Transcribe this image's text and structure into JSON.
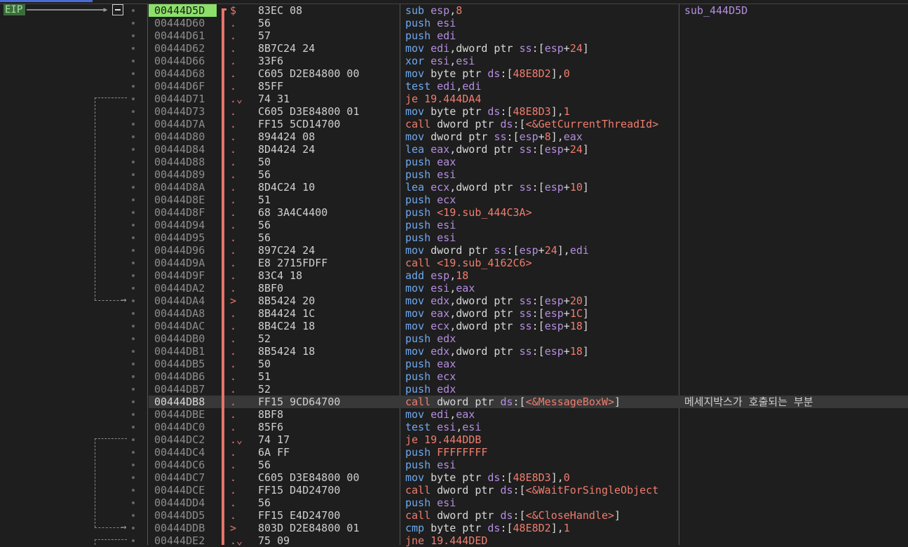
{
  "gutter": {
    "eip_label": "EIP"
  },
  "rows": [
    {
      "addr": "00444D5D",
      "mark": "$",
      "bytes": "83EC 08",
      "dis": [
        [
          "mn",
          "sub "
        ],
        [
          "reg",
          "esp"
        ],
        [
          "txt",
          ","
        ],
        [
          "num",
          "8"
        ]
      ],
      "comment": "sub_444D5D"
    },
    {
      "addr": "00444D60",
      "mark": ".",
      "bytes": "56",
      "dis": [
        [
          "mn",
          "push "
        ],
        [
          "reg",
          "esi"
        ]
      ]
    },
    {
      "addr": "00444D61",
      "mark": ".",
      "bytes": "57",
      "dis": [
        [
          "mn",
          "push "
        ],
        [
          "reg",
          "edi"
        ]
      ]
    },
    {
      "addr": "00444D62",
      "mark": ".",
      "bytes": "8B7C24 24",
      "dis": [
        [
          "mn",
          "mov "
        ],
        [
          "reg",
          "edi"
        ],
        [
          "txt",
          ",dword ptr "
        ],
        [
          "seg",
          "ss"
        ],
        [
          "txt",
          ":["
        ],
        [
          "reg",
          "esp"
        ],
        [
          "txt",
          "+"
        ],
        [
          "num",
          "24"
        ],
        [
          "txt",
          "]"
        ]
      ]
    },
    {
      "addr": "00444D66",
      "mark": ".",
      "bytes": "33F6",
      "dis": [
        [
          "mn",
          "xor "
        ],
        [
          "reg",
          "esi"
        ],
        [
          "txt",
          ","
        ],
        [
          "reg",
          "esi"
        ]
      ]
    },
    {
      "addr": "00444D68",
      "mark": ".",
      "bytes": "C605 D2E84800 00",
      "dis": [
        [
          "mn",
          "mov "
        ],
        [
          "txt",
          "byte ptr "
        ],
        [
          "seg",
          "ds"
        ],
        [
          "txt",
          ":["
        ],
        [
          "num",
          "48E8D2"
        ],
        [
          "txt",
          "],"
        ],
        [
          "num",
          "0"
        ]
      ]
    },
    {
      "addr": "00444D6F",
      "mark": ".",
      "bytes": "85FF",
      "dis": [
        [
          "mn",
          "test "
        ],
        [
          "reg",
          "edi"
        ],
        [
          "txt",
          ","
        ],
        [
          "reg",
          "edi"
        ]
      ]
    },
    {
      "addr": "00444D71",
      "mark": ".⌄",
      "bytes": "74 31",
      "dis": [
        [
          "j",
          "je 19.444DA4"
        ]
      ]
    },
    {
      "addr": "00444D73",
      "mark": ".",
      "bytes": "C605 D3E84800 01",
      "dis": [
        [
          "mn",
          "mov "
        ],
        [
          "txt",
          "byte ptr "
        ],
        [
          "seg",
          "ds"
        ],
        [
          "txt",
          ":["
        ],
        [
          "num",
          "48E8D3"
        ],
        [
          "txt",
          "],"
        ],
        [
          "num",
          "1"
        ]
      ]
    },
    {
      "addr": "00444D7A",
      "mark": ".",
      "bytes": "FF15 5CD14700",
      "dis": [
        [
          "call",
          "call "
        ],
        [
          "txt",
          "dword ptr "
        ],
        [
          "seg",
          "ds"
        ],
        [
          "txt",
          ":["
        ],
        [
          "sym",
          "<&GetCurrentThreadId>"
        ]
      ]
    },
    {
      "addr": "00444D80",
      "mark": ".",
      "bytes": "894424 08",
      "dis": [
        [
          "mn",
          "mov "
        ],
        [
          "txt",
          "dword ptr "
        ],
        [
          "seg",
          "ss"
        ],
        [
          "txt",
          ":["
        ],
        [
          "reg",
          "esp"
        ],
        [
          "txt",
          "+"
        ],
        [
          "num",
          "8"
        ],
        [
          "txt",
          "],"
        ],
        [
          "reg",
          "eax"
        ]
      ]
    },
    {
      "addr": "00444D84",
      "mark": ".",
      "bytes": "8D4424 24",
      "dis": [
        [
          "mn",
          "lea "
        ],
        [
          "reg",
          "eax"
        ],
        [
          "txt",
          ",dword ptr "
        ],
        [
          "seg",
          "ss"
        ],
        [
          "txt",
          ":["
        ],
        [
          "reg",
          "esp"
        ],
        [
          "txt",
          "+"
        ],
        [
          "num",
          "24"
        ],
        [
          "txt",
          "]"
        ]
      ]
    },
    {
      "addr": "00444D88",
      "mark": ".",
      "bytes": "50",
      "dis": [
        [
          "mn",
          "push "
        ],
        [
          "reg",
          "eax"
        ]
      ]
    },
    {
      "addr": "00444D89",
      "mark": ".",
      "bytes": "56",
      "dis": [
        [
          "mn",
          "push "
        ],
        [
          "reg",
          "esi"
        ]
      ]
    },
    {
      "addr": "00444D8A",
      "mark": ".",
      "bytes": "8D4C24 10",
      "dis": [
        [
          "mn",
          "lea "
        ],
        [
          "reg",
          "ecx"
        ],
        [
          "txt",
          ",dword ptr "
        ],
        [
          "seg",
          "ss"
        ],
        [
          "txt",
          ":["
        ],
        [
          "reg",
          "esp"
        ],
        [
          "txt",
          "+"
        ],
        [
          "num",
          "10"
        ],
        [
          "txt",
          "]"
        ]
      ]
    },
    {
      "addr": "00444D8E",
      "mark": ".",
      "bytes": "51",
      "dis": [
        [
          "mn",
          "push "
        ],
        [
          "reg",
          "ecx"
        ]
      ]
    },
    {
      "addr": "00444D8F",
      "mark": ".",
      "bytes": "68 3A4C4400",
      "dis": [
        [
          "mn",
          "push "
        ],
        [
          "sym",
          "<19.sub_444C3A>"
        ]
      ]
    },
    {
      "addr": "00444D94",
      "mark": ".",
      "bytes": "56",
      "dis": [
        [
          "mn",
          "push "
        ],
        [
          "reg",
          "esi"
        ]
      ]
    },
    {
      "addr": "00444D95",
      "mark": ".",
      "bytes": "56",
      "dis": [
        [
          "mn",
          "push "
        ],
        [
          "reg",
          "esi"
        ]
      ]
    },
    {
      "addr": "00444D96",
      "mark": ".",
      "bytes": "897C24 24",
      "dis": [
        [
          "mn",
          "mov "
        ],
        [
          "txt",
          "dword ptr "
        ],
        [
          "seg",
          "ss"
        ],
        [
          "txt",
          ":["
        ],
        [
          "reg",
          "esp"
        ],
        [
          "txt",
          "+"
        ],
        [
          "num",
          "24"
        ],
        [
          "txt",
          "],"
        ],
        [
          "reg",
          "edi"
        ]
      ]
    },
    {
      "addr": "00444D9A",
      "mark": ".",
      "bytes": "E8 2715FDFF",
      "dis": [
        [
          "call",
          "call "
        ],
        [
          "sym",
          "<19.sub_4162C6>"
        ]
      ]
    },
    {
      "addr": "00444D9F",
      "mark": ".",
      "bytes": "83C4 18",
      "dis": [
        [
          "mn",
          "add "
        ],
        [
          "reg",
          "esp"
        ],
        [
          "txt",
          ","
        ],
        [
          "num",
          "18"
        ]
      ]
    },
    {
      "addr": "00444DA2",
      "mark": ".",
      "bytes": "8BF0",
      "dis": [
        [
          "mn",
          "mov "
        ],
        [
          "reg",
          "esi"
        ],
        [
          "txt",
          ","
        ],
        [
          "reg",
          "eax"
        ]
      ]
    },
    {
      "addr": "00444DA4",
      "mark": ">",
      "bytes": "8B5424 20",
      "dis": [
        [
          "mn",
          "mov "
        ],
        [
          "reg",
          "edx"
        ],
        [
          "txt",
          ",dword ptr "
        ],
        [
          "seg",
          "ss"
        ],
        [
          "txt",
          ":["
        ],
        [
          "reg",
          "esp"
        ],
        [
          "txt",
          "+"
        ],
        [
          "num",
          "20"
        ],
        [
          "txt",
          "]"
        ]
      ]
    },
    {
      "addr": "00444DA8",
      "mark": ".",
      "bytes": "8B4424 1C",
      "dis": [
        [
          "mn",
          "mov "
        ],
        [
          "reg",
          "eax"
        ],
        [
          "txt",
          ",dword ptr "
        ],
        [
          "seg",
          "ss"
        ],
        [
          "txt",
          ":["
        ],
        [
          "reg",
          "esp"
        ],
        [
          "txt",
          "+"
        ],
        [
          "num",
          "1C"
        ],
        [
          "txt",
          "]"
        ]
      ]
    },
    {
      "addr": "00444DAC",
      "mark": ".",
      "bytes": "8B4C24 18",
      "dis": [
        [
          "mn",
          "mov "
        ],
        [
          "reg",
          "ecx"
        ],
        [
          "txt",
          ",dword ptr "
        ],
        [
          "seg",
          "ss"
        ],
        [
          "txt",
          ":["
        ],
        [
          "reg",
          "esp"
        ],
        [
          "txt",
          "+"
        ],
        [
          "num",
          "18"
        ],
        [
          "txt",
          "]"
        ]
      ]
    },
    {
      "addr": "00444DB0",
      "mark": ".",
      "bytes": "52",
      "dis": [
        [
          "mn",
          "push "
        ],
        [
          "reg",
          "edx"
        ]
      ]
    },
    {
      "addr": "00444DB1",
      "mark": ".",
      "bytes": "8B5424 18",
      "dis": [
        [
          "mn",
          "mov "
        ],
        [
          "reg",
          "edx"
        ],
        [
          "txt",
          ",dword ptr "
        ],
        [
          "seg",
          "ss"
        ],
        [
          "txt",
          ":["
        ],
        [
          "reg",
          "esp"
        ],
        [
          "txt",
          "+"
        ],
        [
          "num",
          "18"
        ],
        [
          "txt",
          "]"
        ]
      ]
    },
    {
      "addr": "00444DB5",
      "mark": ".",
      "bytes": "50",
      "dis": [
        [
          "mn",
          "push "
        ],
        [
          "reg",
          "eax"
        ]
      ]
    },
    {
      "addr": "00444DB6",
      "mark": ".",
      "bytes": "51",
      "dis": [
        [
          "mn",
          "push "
        ],
        [
          "reg",
          "ecx"
        ]
      ]
    },
    {
      "addr": "00444DB7",
      "mark": ".",
      "bytes": "52",
      "dis": [
        [
          "mn",
          "push "
        ],
        [
          "reg",
          "edx"
        ]
      ]
    },
    {
      "addr": "00444DB8",
      "mark": ".",
      "bytes": "FF15 9CD64700",
      "dis": [
        [
          "call",
          "call "
        ],
        [
          "txt",
          "dword ptr "
        ],
        [
          "seg",
          "ds"
        ],
        [
          "txt",
          ":["
        ],
        [
          "sym",
          "<&MessageBoxW>"
        ],
        [
          "txt",
          "]"
        ]
      ],
      "comment": "메세지박스가 호출되는 부분",
      "hl": true
    },
    {
      "addr": "00444DBE",
      "mark": ".",
      "bytes": "8BF8",
      "dis": [
        [
          "mn",
          "mov "
        ],
        [
          "reg",
          "edi"
        ],
        [
          "txt",
          ","
        ],
        [
          "reg",
          "eax"
        ]
      ]
    },
    {
      "addr": "00444DC0",
      "mark": ".",
      "bytes": "85F6",
      "dis": [
        [
          "mn",
          "test "
        ],
        [
          "reg",
          "esi"
        ],
        [
          "txt",
          ","
        ],
        [
          "reg",
          "esi"
        ]
      ]
    },
    {
      "addr": "00444DC2",
      "mark": ".⌄",
      "bytes": "74 17",
      "dis": [
        [
          "j",
          "je 19.444DDB"
        ]
      ]
    },
    {
      "addr": "00444DC4",
      "mark": ".",
      "bytes": "6A FF",
      "dis": [
        [
          "mn",
          "push "
        ],
        [
          "num",
          "FFFFFFFF"
        ]
      ]
    },
    {
      "addr": "00444DC6",
      "mark": ".",
      "bytes": "56",
      "dis": [
        [
          "mn",
          "push "
        ],
        [
          "reg",
          "esi"
        ]
      ]
    },
    {
      "addr": "00444DC7",
      "mark": ".",
      "bytes": "C605 D3E84800 00",
      "dis": [
        [
          "mn",
          "mov "
        ],
        [
          "txt",
          "byte ptr "
        ],
        [
          "seg",
          "ds"
        ],
        [
          "txt",
          ":["
        ],
        [
          "num",
          "48E8D3"
        ],
        [
          "txt",
          "],"
        ],
        [
          "num",
          "0"
        ]
      ]
    },
    {
      "addr": "00444DCE",
      "mark": ".",
      "bytes": "FF15 D4D24700",
      "dis": [
        [
          "call",
          "call "
        ],
        [
          "txt",
          "dword ptr "
        ],
        [
          "seg",
          "ds"
        ],
        [
          "txt",
          ":["
        ],
        [
          "sym",
          "<&WaitForSingleObject"
        ]
      ]
    },
    {
      "addr": "00444DD4",
      "mark": ".",
      "bytes": "56",
      "dis": [
        [
          "mn",
          "push "
        ],
        [
          "reg",
          "esi"
        ]
      ]
    },
    {
      "addr": "00444DD5",
      "mark": ".",
      "bytes": "FF15 E4D24700",
      "dis": [
        [
          "call",
          "call "
        ],
        [
          "txt",
          "dword ptr "
        ],
        [
          "seg",
          "ds"
        ],
        [
          "txt",
          ":["
        ],
        [
          "sym",
          "<&CloseHandle>"
        ],
        [
          "txt",
          "]"
        ]
      ]
    },
    {
      "addr": "00444DDB",
      "mark": ">",
      "bytes": "803D D2E84800 01",
      "dis": [
        [
          "mn",
          "cmp "
        ],
        [
          "txt",
          "byte ptr "
        ],
        [
          "seg",
          "ds"
        ],
        [
          "txt",
          ":["
        ],
        [
          "num",
          "48E8D2"
        ],
        [
          "txt",
          "],"
        ],
        [
          "num",
          "1"
        ]
      ]
    },
    {
      "addr": "00444DE2",
      "mark": ".⌄",
      "bytes": "75 09",
      "dis": [
        [
          "j",
          "jne 19.444DED"
        ]
      ]
    }
  ]
}
